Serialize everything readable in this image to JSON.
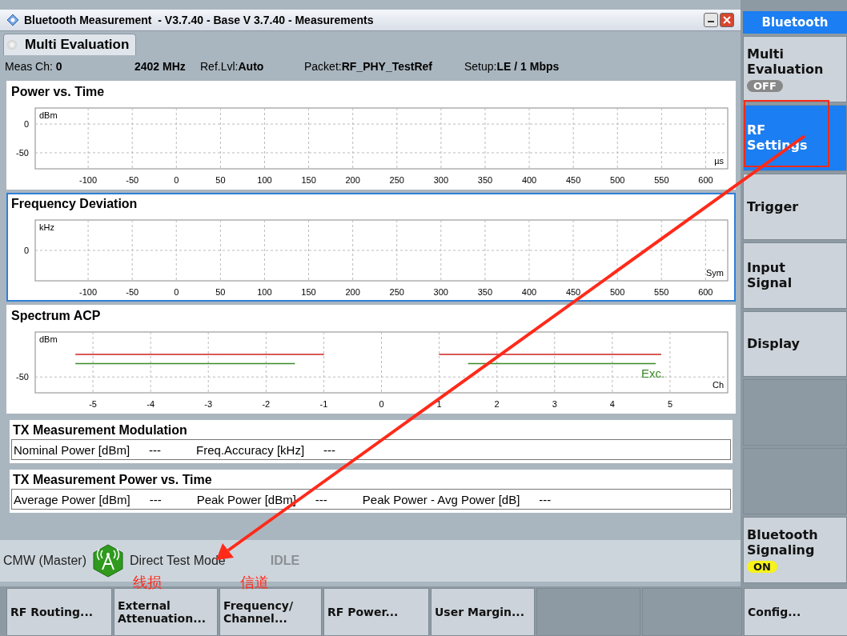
{
  "window": {
    "title": "Bluetooth Measurement  - V3.7.40 - Base V 3.7.40 - Measurements"
  },
  "tab": {
    "label": "Multi Evaluation",
    "selected": true
  },
  "info": [
    {
      "label": "Meas Ch: ",
      "value": "0"
    },
    {
      "value": "2402 MHz"
    },
    {
      "label": "Ref.Lvl:",
      "value": "Auto"
    },
    {
      "label": "Packet:",
      "value": "RF_PHY_TestRef"
    },
    {
      "label": "Setup:",
      "value": "LE / 1 Mbps"
    }
  ],
  "charts": [
    {
      "title": "Power vs. Time",
      "selected": false,
      "chart_data": {
        "type": "line",
        "xlabel": "µs",
        "ylabel": "dBm",
        "grid": true,
        "xlim": [
          -160,
          625
        ],
        "ylim": [
          -78,
          28
        ],
        "xticks": [
          -100,
          -50,
          0,
          50,
          100,
          150,
          200,
          250,
          300,
          350,
          400,
          450,
          500,
          550,
          600
        ],
        "yticks": [
          0,
          -50
        ]
      }
    },
    {
      "title": "Frequency Deviation",
      "selected": true,
      "plot": {
        "kind": "empty",
        "x_unit": "Sym",
        "y_unit": "kHz",
        "x_labels": [
          "-100",
          "-50",
          "0",
          "50",
          "100",
          "150",
          "200",
          "250",
          "300",
          "350",
          "400",
          "450",
          "500",
          "550",
          "600"
        ],
        "y_label": "0"
      }
    },
    {
      "title": "Spectrum ACP",
      "selected": false,
      "plot": {
        "kind": "limit_lines",
        "x_unit": "Ch",
        "y_unit": "dBm",
        "x_labels": [
          "-5",
          "-4",
          "-3",
          "-2",
          "-1",
          "0",
          "1",
          "2",
          "3",
          "4",
          "5"
        ],
        "y_label": "-50",
        "trace_label": "Exc."
      }
    }
  ],
  "tables": [
    {
      "title": "TX Measurement Modulation",
      "fields": [
        {
          "label": "Nominal Power [dBm]",
          "value": "---"
        },
        {
          "label": "Freq.Accuracy [kHz]",
          "value": "---"
        }
      ]
    },
    {
      "title": "TX Measurement Power vs. Time",
      "fields": [
        {
          "label": "Average Power [dBm]",
          "value": "---"
        },
        {
          "label": "Peak Power [dBm]",
          "value": "---"
        },
        {
          "label": "Peak Power - Avg Power [dB]",
          "value": "---"
        }
      ]
    }
  ],
  "status": {
    "instrument": "CMW (Master)",
    "mode": "Direct Test Mode",
    "state": "IDLE"
  },
  "sidebar": {
    "header": "Bluetooth",
    "items": [
      {
        "kind": "toggle",
        "label": "Multi Evaluation",
        "selected": false,
        "toggle": "OFF",
        "on": false
      },
      {
        "kind": "softkey",
        "label": "RF Settings",
        "selected": true
      },
      {
        "kind": "softkey",
        "label": "Trigger",
        "selected": false
      },
      {
        "kind": "softkey",
        "label": "Input Signal",
        "selected": false
      },
      {
        "kind": "softkey",
        "label": "Display",
        "selected": false
      },
      {
        "kind": "blank",
        "selected": false
      },
      {
        "kind": "blank",
        "selected": false
      },
      {
        "kind": "toggle",
        "label": "Bluetooth Signaling",
        "selected": false,
        "toggle": "ON",
        "on": true
      }
    ]
  },
  "bottom_softkeys": [
    {
      "kind": "softkey",
      "label": "RF Routing..."
    },
    {
      "kind": "softkey",
      "label": "External Attenuation..."
    },
    {
      "kind": "softkey",
      "label": "Frequency/ Channel..."
    },
    {
      "kind": "softkey",
      "label": "RF Power..."
    },
    {
      "kind": "softkey",
      "label": "User Margin..."
    },
    {
      "kind": "blank"
    },
    {
      "kind": "blank"
    },
    {
      "kind": "softkey",
      "label": "Config..."
    }
  ],
  "annotations": [
    {
      "kind": "frame"
    },
    {
      "kind": "arrow"
    },
    {
      "kind": "note",
      "text": "线损"
    },
    {
      "kind": "note",
      "text": "信道"
    }
  ]
}
